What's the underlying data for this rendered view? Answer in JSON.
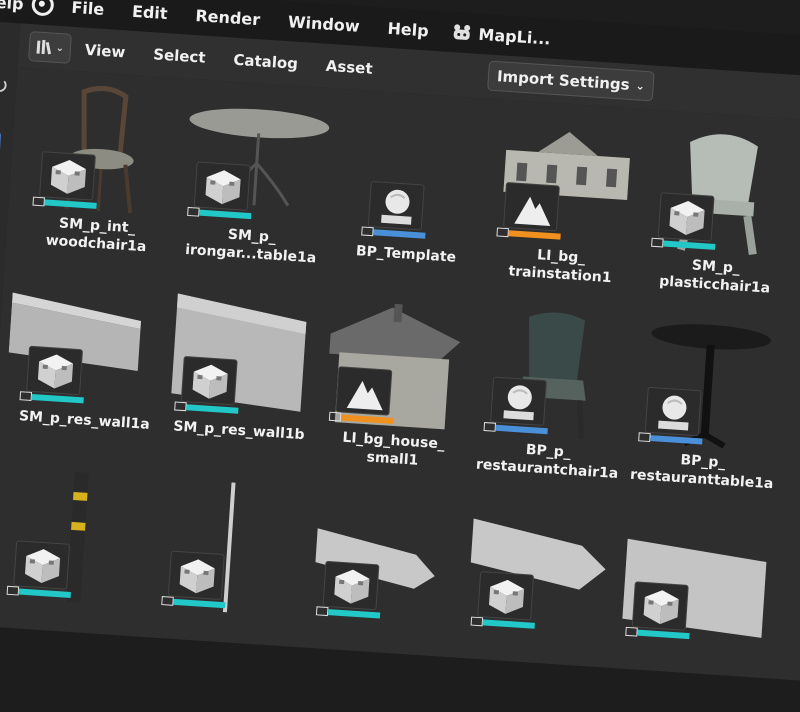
{
  "menubar": {
    "app_fragment": "elp",
    "items": [
      "File",
      "Edit",
      "Render",
      "Window",
      "Help"
    ],
    "plugin_label": "MapLi..."
  },
  "toolbar": {
    "items": [
      "View",
      "Select",
      "Catalog",
      "Asset"
    ],
    "import_label": "Import Settings"
  },
  "colors": {
    "mesh_bar": "#22c7c7",
    "blueprint_bar": "#4a90d9",
    "image_bar": "#f0901e",
    "accent": "#4772b3"
  },
  "assets": [
    {
      "line1": "SM_p_int_",
      "line2": "woodchair1a",
      "type": "mesh"
    },
    {
      "line1": "SM_p_",
      "line2": "irongar...table1a",
      "type": "mesh"
    },
    {
      "line1": "BP_Template",
      "line2": "",
      "type": "blueprint"
    },
    {
      "line1": "LI_bg_",
      "line2": "trainstation1",
      "type": "image"
    },
    {
      "line1": "SM_p_",
      "line2": "plasticchair1a",
      "type": "mesh"
    },
    {
      "line1": "SM_p_res_wall1a",
      "line2": "",
      "type": "mesh"
    },
    {
      "line1": "SM_p_res_wall1b",
      "line2": "",
      "type": "mesh"
    },
    {
      "line1": "LI_bg_house_",
      "line2": "small1",
      "type": "image"
    },
    {
      "line1": "BP_p_",
      "line2": "restaurantchair1a",
      "type": "blueprint"
    },
    {
      "line1": "BP_p_",
      "line2": "restauranttable1a",
      "type": "blueprint"
    },
    {
      "line1": "",
      "line2": "",
      "type": "mesh"
    },
    {
      "line1": "",
      "line2": "",
      "type": "mesh"
    },
    {
      "line1": "",
      "line2": "",
      "type": "mesh"
    },
    {
      "line1": "",
      "line2": "",
      "type": "mesh"
    },
    {
      "line1": "",
      "line2": "",
      "type": "mesh"
    }
  ]
}
